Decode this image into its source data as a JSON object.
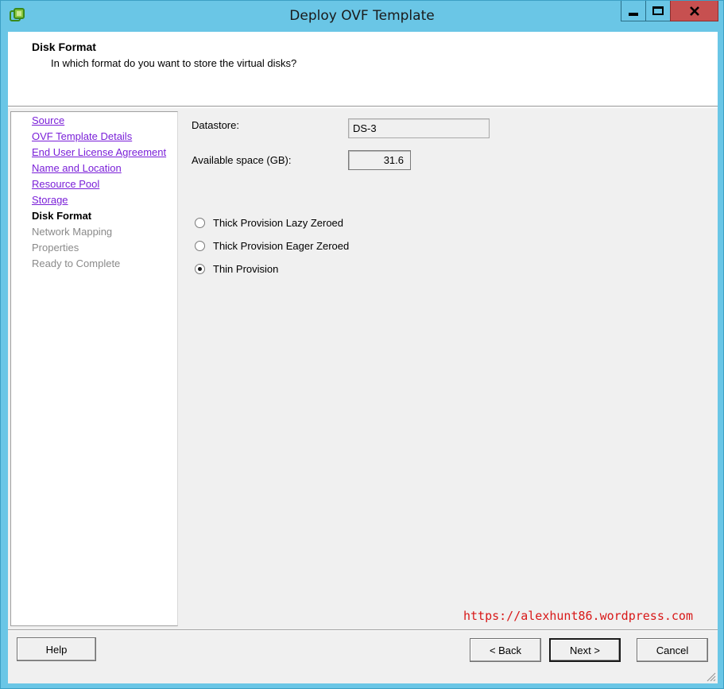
{
  "window": {
    "title": "Deploy OVF Template",
    "icon": "vsphere-app-icon"
  },
  "header": {
    "title": "Disk Format",
    "subtitle": "In which format do you want to store the virtual disks?"
  },
  "nav": {
    "items": [
      {
        "label": "Source",
        "state": "visited"
      },
      {
        "label": "OVF Template Details",
        "state": "visited"
      },
      {
        "label": "End User License Agreement",
        "state": "visited"
      },
      {
        "label": "Name and Location",
        "state": "visited"
      },
      {
        "label": "Resource Pool",
        "state": "visited"
      },
      {
        "label": "Storage",
        "state": "visited"
      },
      {
        "label": "Disk Format",
        "state": "current"
      },
      {
        "label": "Network Mapping",
        "state": "upcoming"
      },
      {
        "label": "Properties",
        "state": "upcoming"
      },
      {
        "label": "Ready to Complete",
        "state": "upcoming"
      }
    ]
  },
  "main": {
    "datastore_label": "Datastore:",
    "datastore_value": "DS-3",
    "space_label": "Available space (GB):",
    "space_value": "31.6",
    "options": [
      {
        "label": "Thick Provision Lazy Zeroed",
        "checked": false
      },
      {
        "label": "Thick Provision Eager Zeroed",
        "checked": false
      },
      {
        "label": "Thin Provision",
        "checked": true
      }
    ]
  },
  "watermark": "https://alexhunt86.wordpress.com",
  "footer": {
    "help_label": "Help",
    "back_label": "< Back",
    "next_label": "Next >",
    "cancel_label": "Cancel"
  },
  "colors": {
    "title_bar": "#6ac6e6",
    "close_button": "#c75050",
    "link": "#7a1fd8",
    "watermark": "#d81818"
  }
}
